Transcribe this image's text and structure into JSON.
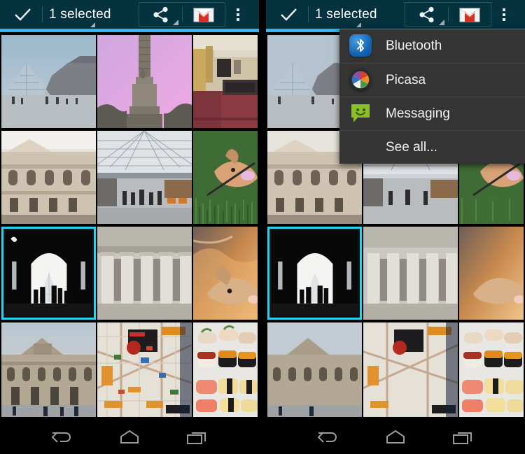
{
  "app": {
    "accent_color": "#33b5e5",
    "actionbar_color": "#04333f",
    "selection_border_color": "#2ad2f0",
    "menu_background": "#343434"
  },
  "actionbar": {
    "done_icon": "check-icon",
    "title": "1 selected",
    "share_icon": "share-icon",
    "gmail_icon": "gmail-icon",
    "overflow_icon": "overflow-menu-icon"
  },
  "share_menu": {
    "items": [
      {
        "label": "Bluetooth",
        "icon": "bluetooth-icon"
      },
      {
        "label": "Picasa",
        "icon": "picasa-icon"
      },
      {
        "label": "Messaging",
        "icon": "messaging-icon"
      }
    ],
    "see_all_label": "See all..."
  },
  "navbar": {
    "back_label": "Back",
    "home_label": "Home",
    "recents_label": "Recent apps"
  },
  "gallery": {
    "columns": 3,
    "rows": 4,
    "selected_index": 6,
    "photos": [
      {
        "name": "louvre-pyramid-courtyard"
      },
      {
        "name": "column-monument-pink-sky"
      },
      {
        "name": "train-carriage-interior"
      },
      {
        "name": "louvre-facade-daylight"
      },
      {
        "name": "station-glass-roof"
      },
      {
        "name": "dog-on-grass"
      },
      {
        "name": "louvre-archway-silhouette"
      },
      {
        "name": "classical-colonnade"
      },
      {
        "name": "dog-closeup-warm"
      },
      {
        "name": "louvre-palace-wide"
      },
      {
        "name": "city-street-map"
      },
      {
        "name": "sushi-platter"
      }
    ]
  }
}
